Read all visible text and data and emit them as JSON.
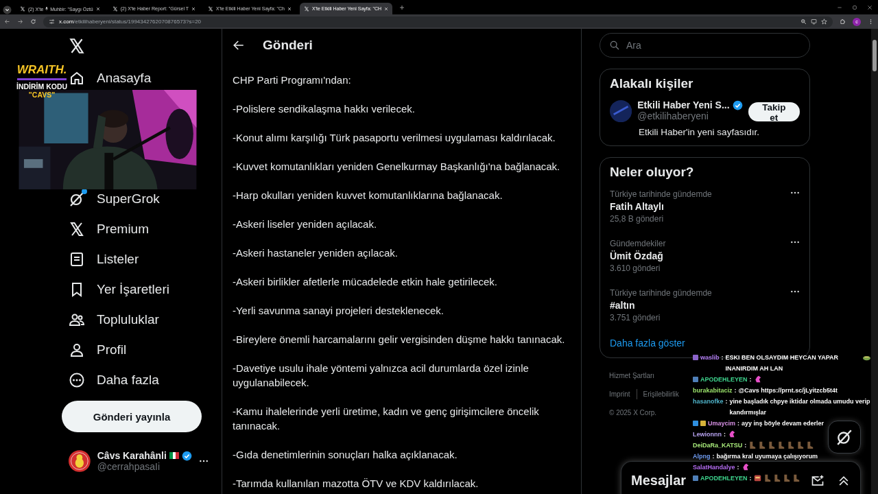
{
  "browser": {
    "tabs": [
      {
        "title": "(2) X'te",
        "audio": true,
        "subtitle": "Muhbir: \"Saygı Öztü",
        "selected": false
      },
      {
        "title": "(2) X'te Haber Report: \"Gürsel T",
        "audio": false,
        "selected": false
      },
      {
        "title": "X'te Etkili Haber Yeni Sayfa: \"Ch",
        "audio": false,
        "selected": false
      },
      {
        "title": "X'te Etkili Haber Yeni Sayfa: \"CH",
        "audio": false,
        "selected": true
      }
    ],
    "url_host": "x.com",
    "url_path": "/etkilihaberyeni/status/1994342762070876573?s=20",
    "profile_initial": "c"
  },
  "sidebar": {
    "nav": [
      {
        "label": "Anasayfa",
        "kind": "home",
        "dot": false
      },
      {
        "label": "SuperGrok",
        "kind": "grok",
        "dot": true
      },
      {
        "label": "Premium",
        "kind": "x",
        "dot": false
      },
      {
        "label": "Listeler",
        "kind": "list",
        "dot": false
      },
      {
        "label": "Yer İşaretleri",
        "kind": "bookmark",
        "dot": false
      },
      {
        "label": "Topluluklar",
        "kind": "people",
        "dot": false
      },
      {
        "label": "Profil",
        "kind": "person",
        "dot": false
      },
      {
        "label": "Daha fazla",
        "kind": "more",
        "dot": false
      }
    ],
    "post_button": "Gönderi yayınla",
    "account": {
      "name": "Câvs Karahânli",
      "handle": "@cerrahpasaIi"
    }
  },
  "post": {
    "title": "Gönderi",
    "lines": [
      "CHP Parti Programı'ndan:",
      "-Polislere sendikalaşma hakkı verilecek.",
      "-Konut alımı karşılığı Türk pasaportu verilmesi uygulaması kaldırılacak.",
      "-Kuvvet komutanlıkları yeniden Genelkurmay Başkanlığı'na bağlanacak.",
      "-Harp okulları yeniden kuvvet komutanlıklarına bağlanacak.",
      "-Askeri liseler yeniden açılacak.",
      "-Askeri hastaneler yeniden açılacak.",
      "-Askeri birlikler afetlerle mücadelede etkin hale getirilecek.",
      "-Yerli savunma sanayi projeleri desteklenecek.",
      "-Bireylere önemli harcamalarını gelir vergisinden düşme hakkı tanınacak.",
      "-Davetiye usulu ihale yöntemi yalnızca acil durumlarda özel izinle uygulanabilecek.",
      "-Kamu ihalelerinde yerli üretime, kadın ve genç girişimcilere öncelik tanınacak.",
      "-Gıda denetimlerinin sonuçları halka açıklanacak.",
      "-Tarımda kullanılan mazotta ÖTV ve KDV kaldırılacak."
    ]
  },
  "aside": {
    "search": {
      "placeholder": "Ara"
    },
    "relevant": {
      "title": "Alakalı kişiler",
      "person": {
        "name": "Etkili Haber Yeni S...",
        "handle": "@etkilihaberyeni",
        "bio": "Etkili Haber'in yeni sayfasıdır.",
        "button": "Takip et"
      }
    },
    "trends": {
      "title": "Neler oluyor?",
      "items": [
        {
          "context": "Türkiye tarihinde gündemde",
          "topic": "Fatih Altaylı",
          "count": "25,8 B gönderi"
        },
        {
          "context": "Gündemdekiler",
          "topic": "Ümit Özdağ",
          "count": "3.610 gönderi"
        },
        {
          "context": "Türkiye tarihinde gündemde",
          "topic": "#altın",
          "count": "3.751 gönderi"
        }
      ],
      "more": "Daha fazla göster"
    },
    "footer": {
      "links": [
        "Hizmet Şartları",
        "Imprint",
        "Erişilebilirlik"
      ],
      "copyright": "© 2025 X Corp."
    },
    "messages_drawer": {
      "title": "Mesajlar"
    }
  },
  "stream": {
    "sponsor": {
      "brand": "WRAITH.",
      "line1": "İNDİRİM KODU",
      "line2": "\"CAVS\""
    },
    "chat": [
      {
        "user": "waslib",
        "color": "#b07cf0",
        "badges": [
          {
            "color": "#8a63c9"
          }
        ],
        "sep": ":",
        "text": "ESKI BEN OLSAYDIM HEYCAN YAPAR INANIRDIM AH LAN",
        "emotes": [
          {
            "kind": "frog"
          }
        ]
      },
      {
        "user": "APODEHLEYEN",
        "color": "#3fd68f",
        "badges": [
          {
            "color": "#4f7fb8"
          }
        ],
        "sep": ":",
        "emotes": [
          {
            "kind": "pink"
          }
        ]
      },
      {
        "user": "burakabitaciz",
        "color": "#9be36b",
        "sep": ":",
        "text": "@Cavs https://prnt.sc/jLyitzcb5t4t"
      },
      {
        "user": "hasanofke",
        "color": "#4fb3c9",
        "sep": ":",
        "text": "yine başladık chpye iktidar olmada umudu verip kandırmışlar"
      },
      {
        "user": "Umaycim",
        "color": "#d891e6",
        "badges": [
          {
            "color": "#2f8fe0"
          },
          {
            "color": "#d7b23a"
          }
        ],
        "sep": ":",
        "text": "ayy inş böyle devam ederler"
      },
      {
        "user": "Lewionnn",
        "color": "#b9a4f2",
        "sep": ":",
        "emotes": [
          {
            "kind": "pink"
          }
        ]
      },
      {
        "user": "DeiDaRa_KATSU",
        "color": "#a8ea7a",
        "sep": ":",
        "emotes": [
          {
            "kind": "boot"
          },
          {
            "kind": "boot"
          },
          {
            "kind": "boot"
          },
          {
            "kind": "boot"
          },
          {
            "kind": "boot"
          },
          {
            "kind": "boot"
          },
          {
            "kind": "boot"
          }
        ]
      },
      {
        "user": "Alpng",
        "color": "#6f9bf0",
        "sep": ":",
        "text": "bağırma kral uyumaya çalışıyorum"
      },
      {
        "user": "SalatHandalye",
        "color": "#b36cf0",
        "sep": ":",
        "emotes": [
          {
            "kind": "pink"
          }
        ]
      },
      {
        "user": "APODEHLEYEN",
        "color": "#3fd68f",
        "badges": [
          {
            "color": "#4f7fb8"
          }
        ],
        "sep": ":",
        "emotes": [
          {
            "kind": "box"
          },
          {
            "kind": "boot"
          },
          {
            "kind": "boot"
          },
          {
            "kind": "boot"
          },
          {
            "kind": "boot"
          }
        ]
      }
    ]
  }
}
